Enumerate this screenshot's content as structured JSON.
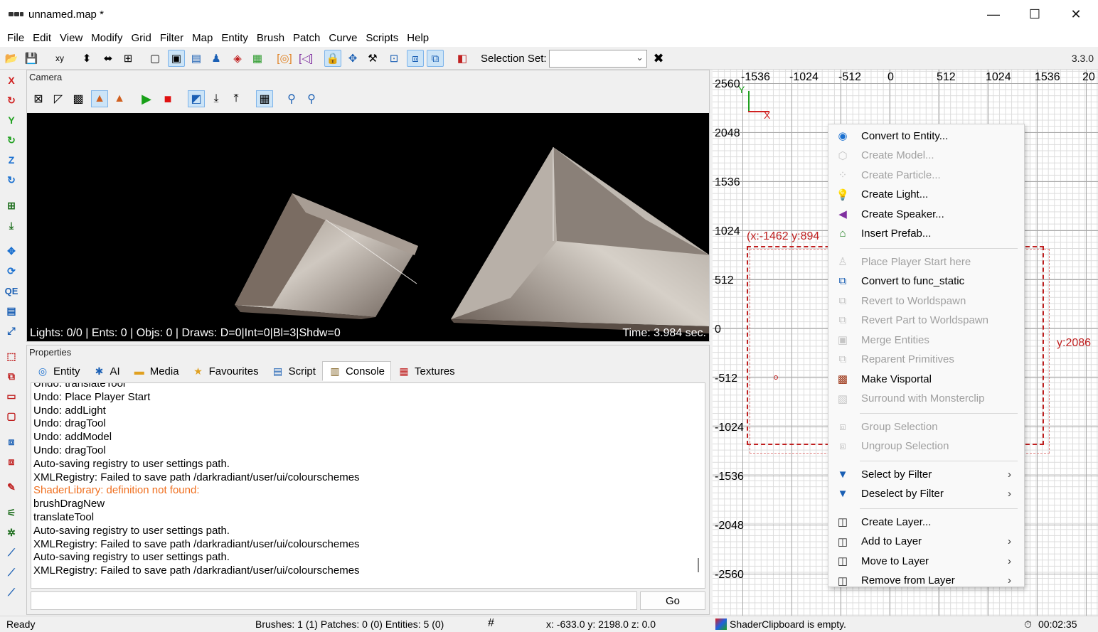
{
  "window": {
    "title": "unnamed.map *",
    "minimize": "—",
    "maximize": "☐",
    "close": "✕"
  },
  "menu": [
    "File",
    "Edit",
    "View",
    "Modify",
    "Grid",
    "Filter",
    "Map",
    "Entity",
    "Brush",
    "Patch",
    "Curve",
    "Scripts",
    "Help"
  ],
  "toolbar": {
    "selection_set_label": "Selection Set:",
    "selection_set_value": "",
    "version": "3.3.0"
  },
  "camera": {
    "title": "Camera",
    "stats": "Lights: 0/0 | Ents: 0 | Objs: 0 | Draws: D=0|Int=0|Bl=3|Shdw=0",
    "time": "Time: 3.984 sec."
  },
  "properties": {
    "title": "Properties",
    "tabs": [
      {
        "label": "Entity",
        "icon": "entity-icon"
      },
      {
        "label": "AI",
        "icon": "ai-icon"
      },
      {
        "label": "Media",
        "icon": "folder-icon"
      },
      {
        "label": "Favourites",
        "icon": "star-icon"
      },
      {
        "label": "Script",
        "icon": "script-icon"
      },
      {
        "label": "Console",
        "icon": "console-icon"
      },
      {
        "label": "Textures",
        "icon": "textures-icon"
      }
    ],
    "active_tab": "Console",
    "console_lines": [
      {
        "text": "Undo: translateTool",
        "warn": false
      },
      {
        "text": "Undo: Place Player Start",
        "warn": false
      },
      {
        "text": "Undo: addLight",
        "warn": false
      },
      {
        "text": "Undo: dragTool",
        "warn": false
      },
      {
        "text": "Undo: addModel",
        "warn": false
      },
      {
        "text": "Undo: dragTool",
        "warn": false
      },
      {
        "text": "Auto-saving registry to user settings path.",
        "warn": false
      },
      {
        "text": "XMLRegistry: Failed to save path /darkradiant/user/ui/colourschemes",
        "warn": false
      },
      {
        "text": "ShaderLibrary: definition not found:",
        "warn": true
      },
      {
        "text": "brushDragNew",
        "warn": false
      },
      {
        "text": "translateTool",
        "warn": false
      },
      {
        "text": "Auto-saving registry to user settings path.",
        "warn": false
      },
      {
        "text": "XMLRegistry: Failed to save path /darkradiant/user/ui/colourschemes",
        "warn": false
      },
      {
        "text": "Auto-saving registry to user settings path.",
        "warn": false
      },
      {
        "text": "XMLRegistry: Failed to save path /darkradiant/user/ui/colourschemes",
        "warn": false
      }
    ],
    "command_value": "",
    "go_label": "Go"
  },
  "ortho": {
    "x_labels": [
      "-1536",
      "-1024",
      "-512",
      "0",
      "512",
      "1024",
      "1536",
      "20"
    ],
    "y_labels": [
      "2560",
      "2048",
      "1536",
      "1024",
      "512",
      "0",
      "-512",
      "-1024",
      "-1536",
      "-2048",
      "-2560"
    ],
    "axis_x": "X",
    "axis_y": "Y",
    "selection_coord": "(x:-1462  y:894",
    "selection_height": "y:2086"
  },
  "context_menu": [
    {
      "label": "Convert to Entity...",
      "icon": "entity-icon",
      "enabled": true
    },
    {
      "label": "Create Model...",
      "icon": "model-icon",
      "enabled": false
    },
    {
      "label": "Create Particle...",
      "icon": "particle-icon",
      "enabled": false
    },
    {
      "label": "Create Light...",
      "icon": "light-bulb-icon",
      "enabled": true
    },
    {
      "label": "Create Speaker...",
      "icon": "speaker-icon",
      "enabled": true
    },
    {
      "label": "Insert Prefab...",
      "icon": "prefab-house-icon",
      "enabled": true
    },
    {
      "separator": true
    },
    {
      "label": "Place Player Start here",
      "icon": "player-start-icon",
      "enabled": false
    },
    {
      "label": "Convert to func_static",
      "icon": "func-static-icon",
      "enabled": true
    },
    {
      "label": "Revert to Worldspawn",
      "icon": "revert-icon",
      "enabled": false
    },
    {
      "label": "Revert Part to Worldspawn",
      "icon": "revert-part-icon",
      "enabled": false
    },
    {
      "label": "Merge Entities",
      "icon": "merge-icon",
      "enabled": false
    },
    {
      "label": "Reparent Primitives",
      "icon": "reparent-icon",
      "enabled": false
    },
    {
      "label": "Make Visportal",
      "icon": "visportal-icon",
      "enabled": true
    },
    {
      "label": "Surround with Monsterclip",
      "icon": "monsterclip-icon",
      "enabled": false
    },
    {
      "separator": true
    },
    {
      "label": "Group Selection",
      "icon": "group-icon",
      "enabled": false
    },
    {
      "label": "Ungroup Selection",
      "icon": "ungroup-icon",
      "enabled": false
    },
    {
      "separator": true
    },
    {
      "label": "Select by Filter",
      "icon": "filter-funnel-icon",
      "enabled": true,
      "submenu": true
    },
    {
      "label": "Deselect by Filter",
      "icon": "filter-funnel-icon",
      "enabled": true,
      "submenu": true
    },
    {
      "separator": true
    },
    {
      "label": "Create Layer...",
      "icon": "layer-icon",
      "enabled": true
    },
    {
      "label": "Add to Layer",
      "icon": "layer-icon",
      "enabled": true,
      "submenu": true
    },
    {
      "label": "Move to Layer",
      "icon": "layer-icon",
      "enabled": true,
      "submenu": true
    },
    {
      "label": "Remove from Layer",
      "icon": "layer-icon",
      "enabled": true,
      "submenu": true
    }
  ],
  "status": {
    "ready": "Ready",
    "counts": "Brushes: 1 (1) Patches: 0 (0) Entities: 5 (0)",
    "coords": "x: -633.0 y: 2198.0 z:    0.0",
    "clipboard": "ShaderClipboard is empty.",
    "timer": "00:02:35"
  },
  "colors": {
    "accent_blue": "#1a5fb4",
    "selection_red": "#c02020",
    "warning_orange": "#f07020"
  }
}
